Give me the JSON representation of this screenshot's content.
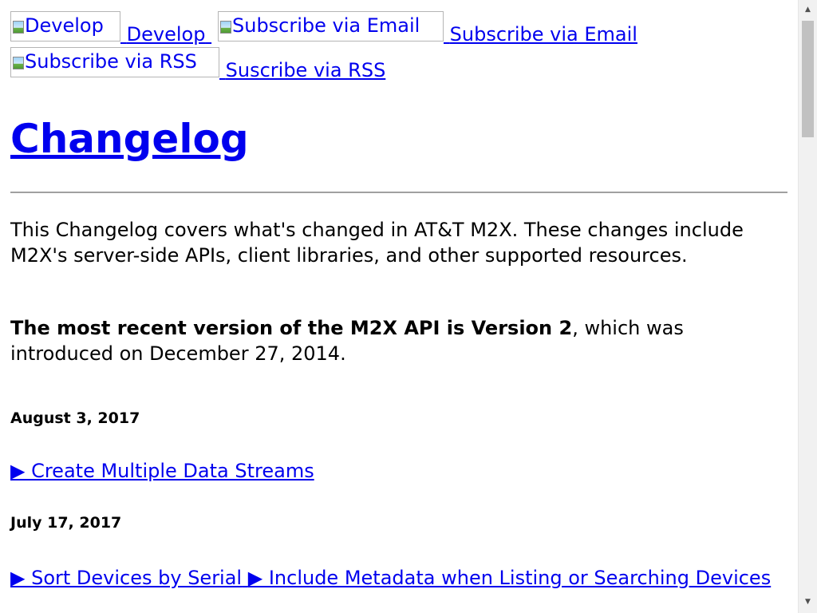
{
  "nav": {
    "develop_img_alt": "Develop",
    "develop_link": "Develop",
    "email_img_alt": "Subscribe via Email",
    "email_link": "Subscribe via Email",
    "rss_img_alt": "Subscribe via RSS",
    "rss_link": "Suscribe via RSS"
  },
  "page": {
    "title": "Changelog",
    "intro": "This Changelog covers what's changed in AT&T M2X. These changes include M2X's server-side APIs, client libraries, and other supported resources.",
    "version_bold": "The most recent version of the M2X API is Version 2",
    "version_rest": ", which was introduced on December 27, 2014."
  },
  "changelog": [
    {
      "date": "August 3, 2017",
      "entries": [
        "▶ Create Multiple Data Streams"
      ]
    },
    {
      "date": "July 17, 2017",
      "entries": [
        "▶ Sort Devices by Serial",
        "▶ Include Metadata when Listing or Searching Devices"
      ]
    }
  ],
  "scrollbar": {
    "up_icon": "▲",
    "down_icon": "▼"
  }
}
